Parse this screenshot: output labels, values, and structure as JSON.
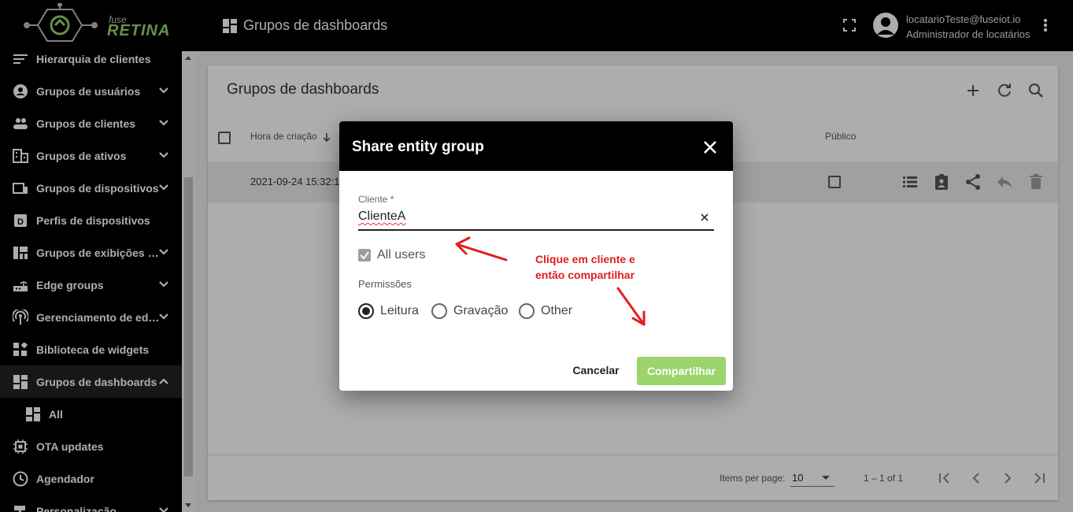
{
  "logo": {
    "fuse": "fuse",
    "retina": "RETINA"
  },
  "header": {
    "title": "Grupos de dashboards",
    "user_email": "locatarioTeste@fuseiot.io",
    "user_role": "Administrador de locatários"
  },
  "sidebar": {
    "items": [
      {
        "label": "Hierarquia de clientes",
        "icon": "hierarchy-icon",
        "chevron": false
      },
      {
        "label": "Grupos de usuários",
        "icon": "account-circle-icon",
        "chevron": "down"
      },
      {
        "label": "Grupos de clientes",
        "icon": "people-icon",
        "chevron": "down"
      },
      {
        "label": "Grupos de ativos",
        "icon": "building-icon",
        "chevron": "down"
      },
      {
        "label": "Grupos de dispositivos",
        "icon": "devices-icon",
        "chevron": "down"
      },
      {
        "label": "Perfis de dispositivos",
        "icon": "device-profile-icon",
        "chevron": false
      },
      {
        "label": "Grupos de exibições de entidades",
        "icon": "view-quilt-icon",
        "chevron": "down"
      },
      {
        "label": "Edge groups",
        "icon": "router-icon",
        "chevron": "down"
      },
      {
        "label": "Gerenciamento de edge",
        "icon": "antenna-icon",
        "chevron": "down"
      },
      {
        "label": "Biblioteca de widgets",
        "icon": "widgets-icon",
        "chevron": false
      },
      {
        "label": "Grupos de dashboards",
        "icon": "dashboard-icon",
        "chevron": "up"
      },
      {
        "label": "All",
        "icon": "dashboard-icon",
        "chevron": false
      },
      {
        "label": "OTA updates",
        "icon": "chip-icon",
        "chevron": false
      },
      {
        "label": "Agendador",
        "icon": "clock-icon",
        "chevron": false
      },
      {
        "label": "Personalização",
        "icon": "brush-icon",
        "chevron": "down"
      }
    ]
  },
  "card": {
    "title": "Grupos de dashboards",
    "columns": {
      "created": "Hora de criação",
      "public": "Público"
    },
    "rows": [
      {
        "created": "2021-09-24 15:32:1",
        "public": false
      }
    ],
    "pager": {
      "items_per_page_label": "Items per page:",
      "items_per_page": "10",
      "range": "1 – 1 of 1"
    }
  },
  "dialog": {
    "title": "Share entity group",
    "field_label": "Cliente *",
    "field_value": "ClienteA",
    "all_users_label": "All users",
    "permissions_label": "Permissões",
    "options": [
      "Leitura",
      "Gravação",
      "Other"
    ],
    "selected_option": "Leitura",
    "cancel_label": "Cancelar",
    "share_label": "Compartilhar"
  },
  "annotation": {
    "line1": "Clique em cliente e",
    "line2": "então compartilhar"
  },
  "colors": {
    "brand": "#9bd46a",
    "annotation": "#e01e1e",
    "header": "#000000"
  }
}
